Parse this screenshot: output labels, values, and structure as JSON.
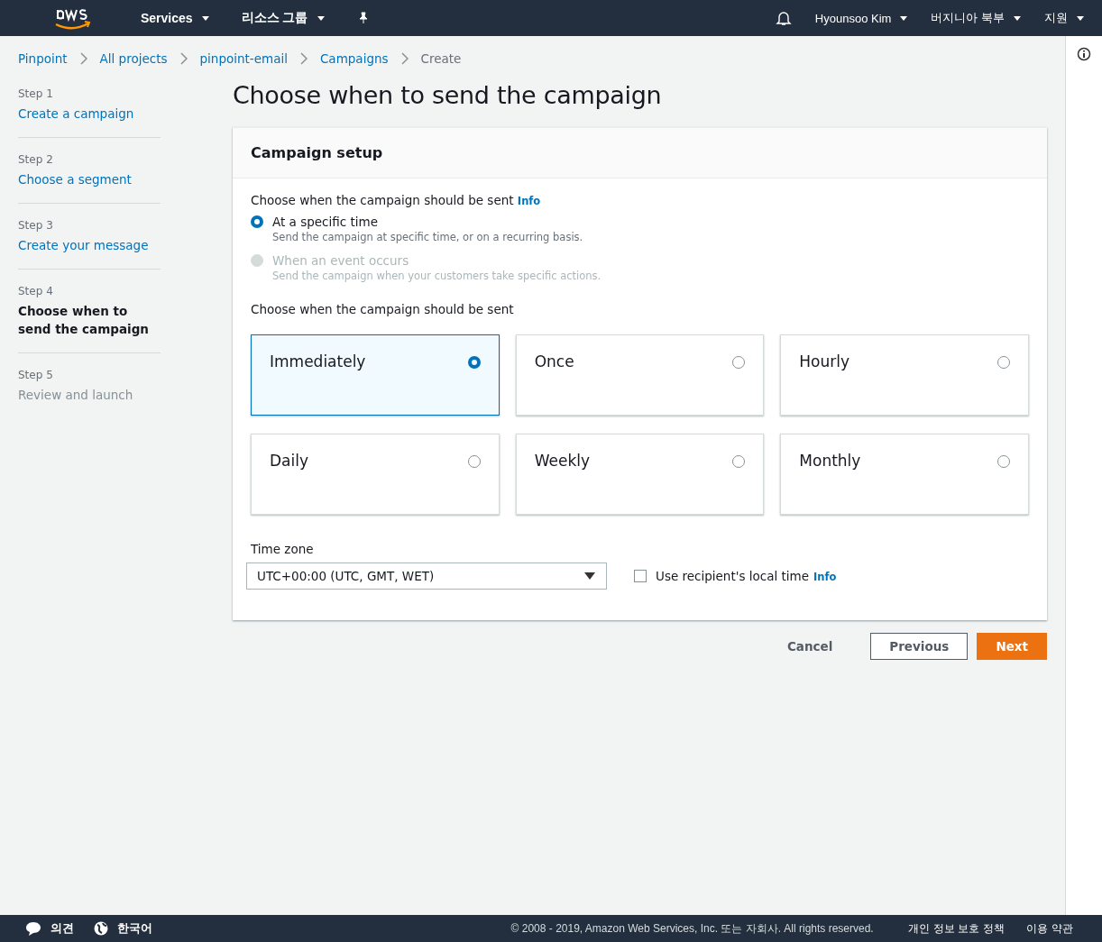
{
  "topnav": {
    "services": "Services",
    "resource_groups": "리소스 그룹",
    "user": "Hyounsoo Kim",
    "region": "버지니아 북부",
    "support": "지원"
  },
  "breadcrumb": [
    {
      "label": "Pinpoint",
      "link": true
    },
    {
      "label": "All projects",
      "link": true
    },
    {
      "label": "pinpoint-email",
      "link": true
    },
    {
      "label": "Campaigns",
      "link": true
    },
    {
      "label": "Create",
      "link": false
    }
  ],
  "steps": [
    {
      "step": "Step 1",
      "label": "Create a campaign",
      "kind": "done"
    },
    {
      "step": "Step 2",
      "label": "Choose a segment",
      "kind": "done"
    },
    {
      "step": "Step 3",
      "label": "Create your message",
      "kind": "done"
    },
    {
      "step": "Step 4",
      "label": "Choose when to send the campaign",
      "kind": "current"
    },
    {
      "step": "Step 5",
      "label": "Review and launch",
      "kind": "upcoming"
    }
  ],
  "page_title": "Choose when to send the campaign",
  "panel": {
    "title": "Campaign setup",
    "mode_label": "Choose when the campaign should be sent",
    "mode_info": "Info",
    "modes": [
      {
        "label": "At a specific time",
        "description": "Send the campaign at specific time, or on a recurring basis.",
        "selected": true,
        "disabled": false
      },
      {
        "label": "When an event occurs",
        "description": "Send the campaign when your customers take specific actions.",
        "selected": false,
        "disabled": true
      }
    ],
    "frequency_label": "Choose when the campaign should be sent",
    "frequencies": [
      {
        "label": "Immediately",
        "selected": true
      },
      {
        "label": "Once",
        "selected": false
      },
      {
        "label": "Hourly",
        "selected": false
      },
      {
        "label": "Daily",
        "selected": false
      },
      {
        "label": "Weekly",
        "selected": false
      },
      {
        "label": "Monthly",
        "selected": false
      }
    ],
    "timezone_label": "Time zone",
    "timezone_value": "UTC+00:00 (UTC, GMT, WET)",
    "local_time": {
      "label": "Use recipient's local time",
      "checked": false,
      "info": "Info"
    }
  },
  "actions": {
    "cancel": "Cancel",
    "previous": "Previous",
    "next": "Next"
  },
  "footer": {
    "feedback": "의견",
    "language": "한국어",
    "copyright": "© 2008 - 2019, Amazon Web Services, Inc. 또는 자회사. All rights reserved.",
    "privacy": "개인 정보 보호 정책",
    "terms": "이용 약관"
  }
}
